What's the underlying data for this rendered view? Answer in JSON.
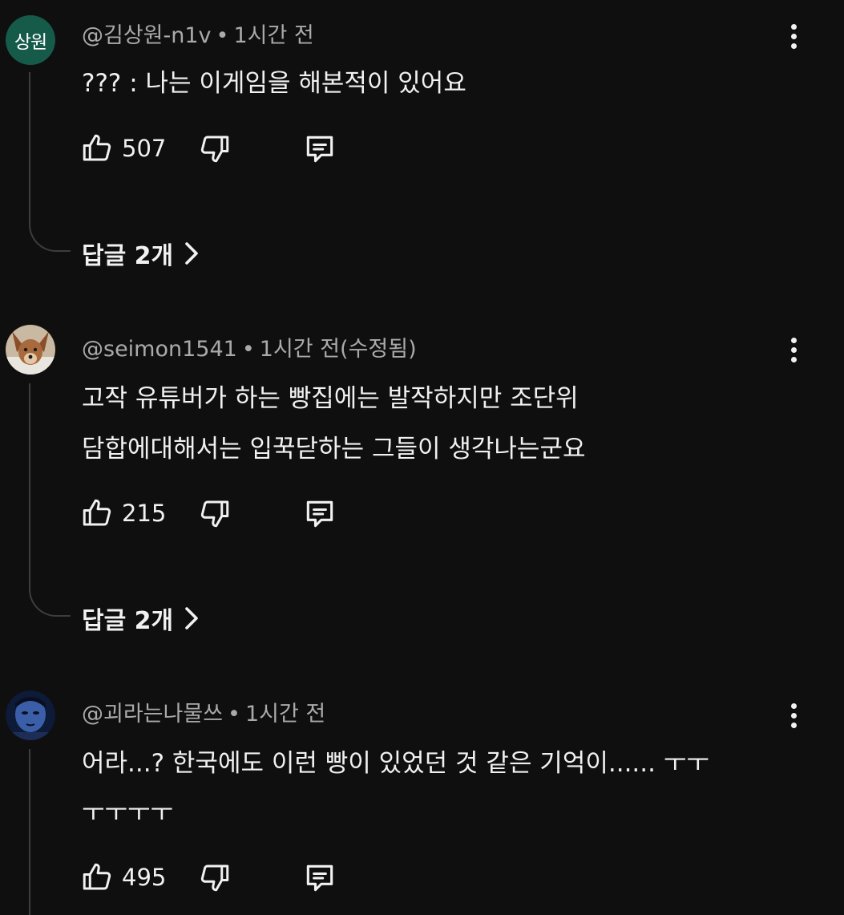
{
  "comments": [
    {
      "avatar_text": "상원",
      "avatar_color": "#165a4a",
      "author": "@김상원-n1v",
      "separator": "•",
      "time": "1시간 전",
      "lines": [
        "??? : 나는 이게임을 해본적이 있어요"
      ],
      "likes": "507",
      "replies_label": "답글 2개",
      "icons": [
        "thumbs-up-icon",
        "thumbs-down-icon",
        "reply-icon",
        "more-vert-icon",
        "chevron-right-icon"
      ]
    },
    {
      "avatar_text": "",
      "avatar_kind": "dog-photo",
      "author": "@seimon1541",
      "separator": "•",
      "time": "1시간 전(수정됨)",
      "lines": [
        "고작 유튜버가 하는  빵집에는 발작하지만  조단위",
        "담합에대해서는  입꾹닫하는 그들이 생각나는군요"
      ],
      "likes": "215",
      "replies_label": "답글 2개"
    },
    {
      "avatar_text": "",
      "avatar_kind": "person-photo",
      "author": "@괴라는나물쓰",
      "separator": "•",
      "time": "1시간 전",
      "lines": [
        "어라...? 한국에도 이런 빵이 있었던 것 같은 기억이...... ㅜㅜ",
        "ㅜㅜㅜㅜ"
      ],
      "likes": "495"
    }
  ],
  "colors": {
    "background": "#0f0f0f",
    "text_primary": "#f1f1f1",
    "text_secondary": "#aaaaaa",
    "thread_line": "#3d3d3d"
  }
}
